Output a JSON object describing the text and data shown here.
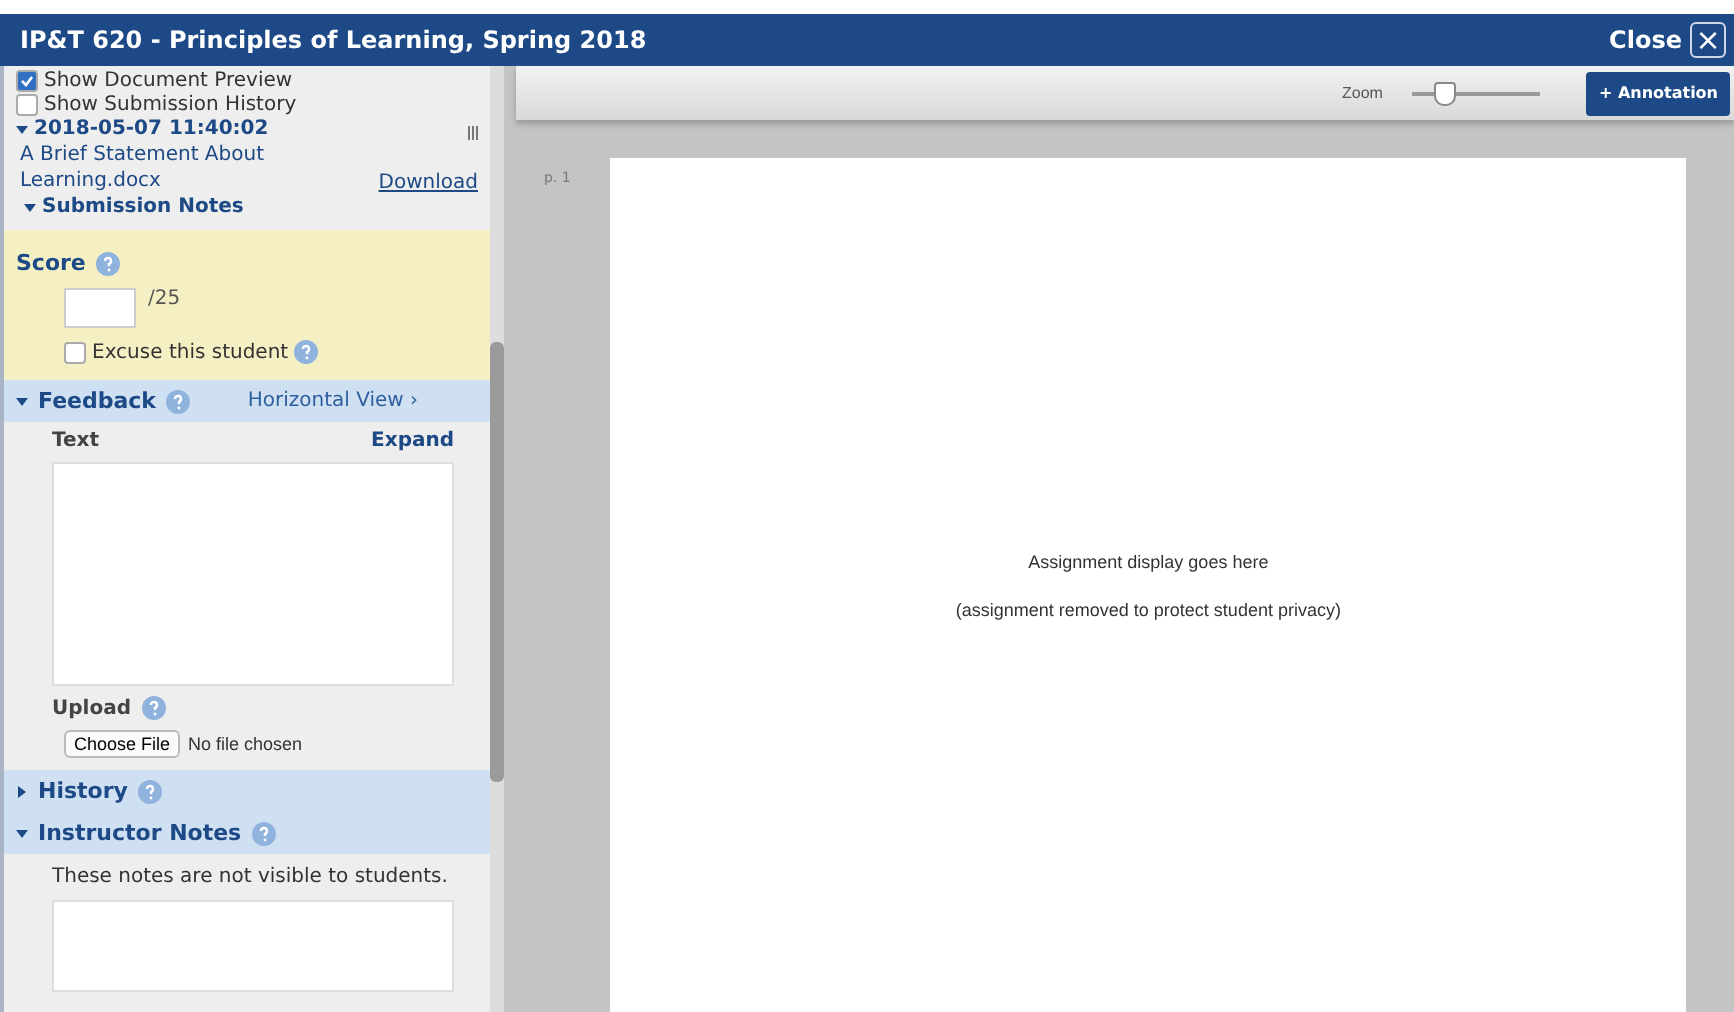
{
  "window": {
    "title": "IP&T 620 - Principles of Learning, Spring 2018",
    "close_label": "Close",
    "close_glyph": "×"
  },
  "options": [
    {
      "label": "Show Document Preview",
      "checked": true
    },
    {
      "label": "Show Submission History",
      "checked": false
    }
  ],
  "submission": {
    "expanded": true,
    "date": "2018-05-07 11:40:02",
    "file": "A Brief Statement About Learning.docx",
    "download": "Download",
    "notes_label": "Submission Notes",
    "notes_expanded": true
  },
  "score": {
    "label": "Score",
    "out_of": "/25",
    "excuse": {
      "label": "Excuse this student",
      "checked": false
    }
  },
  "feedback": {
    "label": "Feedback",
    "expanded": true,
    "view_link": "Horizontal View ›",
    "text_label": "Text",
    "expand": "Expand",
    "upload_label": "Upload",
    "choose_file": "Choose File",
    "file_status": "No file chosen"
  },
  "history": {
    "label": "History",
    "expanded": false
  },
  "instructor_notes": {
    "label": "Instructor Notes",
    "expanded": true,
    "hint": "These notes are not visible to students."
  },
  "toolbar": {
    "zoom_label": "Zoom",
    "zoom": {
      "level": 0.25
    },
    "annotation": "+ Annotation"
  },
  "document": {
    "page_label": "p. 1",
    "lines": [
      "Assignment display goes here",
      "(assignment removed to protect student privacy)"
    ]
  }
}
